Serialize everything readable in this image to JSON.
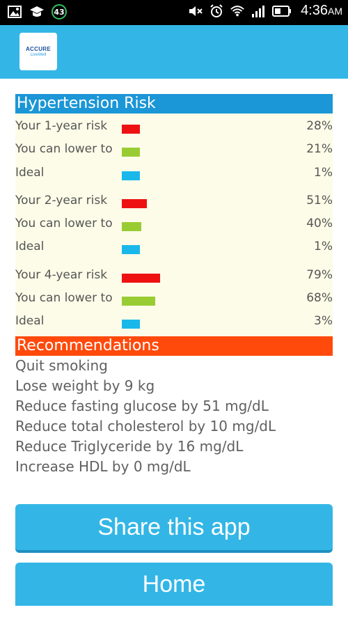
{
  "status_bar": {
    "battery_badge": "43",
    "time": "4:36",
    "time_suffix": "AM"
  },
  "app": {
    "logo_line1": "ACCURE",
    "logo_line2": "LiveWell"
  },
  "risk_section": {
    "title": "Hypertension Risk",
    "header_color": "#1b96d6",
    "rows": [
      {
        "label": "Your 1-year risk",
        "value": "28%",
        "fraction": 0.28,
        "color": "#ee1111"
      },
      {
        "label": "You can lower to",
        "value": "21%",
        "fraction": 0.21,
        "color": "#99cc33"
      },
      {
        "label": "Ideal",
        "value": "1%",
        "fraction": 0.01,
        "color": "#1ab8ea"
      },
      {
        "label": "Your 2-year risk",
        "value": "51%",
        "fraction": 0.51,
        "color": "#ee1111"
      },
      {
        "label": "You can lower to",
        "value": "40%",
        "fraction": 0.4,
        "color": "#99cc33"
      },
      {
        "label": "Ideal",
        "value": "1%",
        "fraction": 0.01,
        "color": "#1ab8ea"
      },
      {
        "label": "Your 4-year risk",
        "value": "79%",
        "fraction": 0.79,
        "color": "#ee1111"
      },
      {
        "label": "You can lower to",
        "value": "68%",
        "fraction": 0.68,
        "color": "#99cc33"
      },
      {
        "label": "Ideal",
        "value": "3%",
        "fraction": 0.03,
        "color": "#1ab8ea"
      }
    ]
  },
  "recommendations": {
    "title": "Recommendations",
    "header_color": "#ff4a0c",
    "items": [
      "Quit smoking",
      "Lose weight by 9 kg",
      "Reduce fasting glucose by 51 mg/dL",
      "Reduce total cholesterol by 10 mg/dL",
      "Reduce Triglyceride by 16 mg/dL",
      "Increase HDL by 0 mg/dL"
    ]
  },
  "buttons": {
    "share_label": "Share this app",
    "home_label": "Home"
  }
}
